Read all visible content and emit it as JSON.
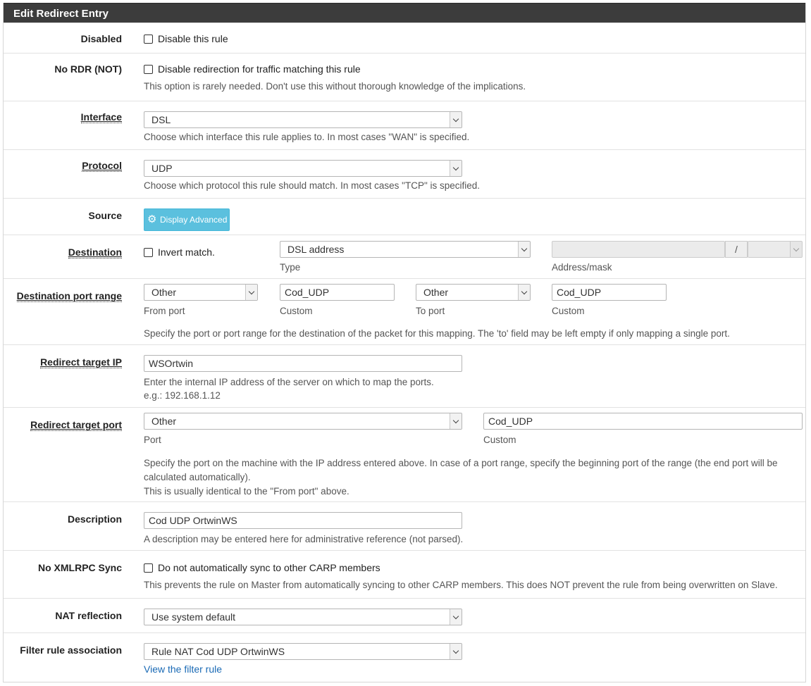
{
  "panel": {
    "title": "Edit Redirect Entry"
  },
  "disabled": {
    "label": "Disabled",
    "checkbox_label": "Disable this rule"
  },
  "no_rdr": {
    "label": "No RDR (NOT)",
    "checkbox_label": "Disable redirection for traffic matching this rule",
    "help": "This option is rarely needed. Don't use this without thorough knowledge of the implications."
  },
  "interface": {
    "label": "Interface",
    "value": "DSL",
    "help": "Choose which interface this rule applies to. In most cases \"WAN\" is specified."
  },
  "protocol": {
    "label": "Protocol",
    "value": "UDP",
    "help": "Choose which protocol this rule should match. In most cases \"TCP\" is specified."
  },
  "source": {
    "label": "Source",
    "button_label": "Display Advanced",
    "button_icon": "gear-icon"
  },
  "destination": {
    "label": "Destination",
    "invert_label": "Invert match.",
    "type_value": "DSL address",
    "type_sublabel": "Type",
    "address_sublabel": "Address/mask",
    "slash": "/"
  },
  "dest_port_range": {
    "label": "Destination port range",
    "from_port_value": "Other",
    "from_port_sublabel": "From port",
    "from_custom_value": "Cod_UDP",
    "from_custom_sublabel": "Custom",
    "to_port_value": "Other",
    "to_port_sublabel": "To port",
    "to_custom_value": "Cod_UDP",
    "to_custom_sublabel": "Custom",
    "help": "Specify the port or port range for the destination of the packet for this mapping. The 'to' field may be left empty if only mapping a single port."
  },
  "redirect_ip": {
    "label": "Redirect target IP",
    "value": "WSOrtwin",
    "help1": "Enter the internal IP address of the server on which to map the ports.",
    "help2": "e.g.: 192.168.1.12"
  },
  "redirect_port": {
    "label": "Redirect target port",
    "port_value": "Other",
    "port_sublabel": "Port",
    "custom_value": "Cod_UDP",
    "custom_sublabel": "Custom",
    "help1": "Specify the port on the machine with the IP address entered above. In case of a port range, specify the beginning port of the range (the end port will be calculated automatically).",
    "help2": "This is usually identical to the \"From port\" above."
  },
  "description": {
    "label": "Description",
    "value": "Cod UDP OrtwinWS",
    "help": "A description may be entered here for administrative reference (not parsed)."
  },
  "xmlrpc": {
    "label": "No XMLRPC Sync",
    "checkbox_label": "Do not automatically sync to other CARP members",
    "help": "This prevents the rule on Master from automatically syncing to other CARP members. This does NOT prevent the rule from being overwritten on Slave."
  },
  "nat_reflection": {
    "label": "NAT reflection",
    "value": "Use system default"
  },
  "filter_rule": {
    "label": "Filter rule association",
    "value": "Rule NAT Cod UDP OrtwinWS",
    "link": "View the filter rule"
  }
}
